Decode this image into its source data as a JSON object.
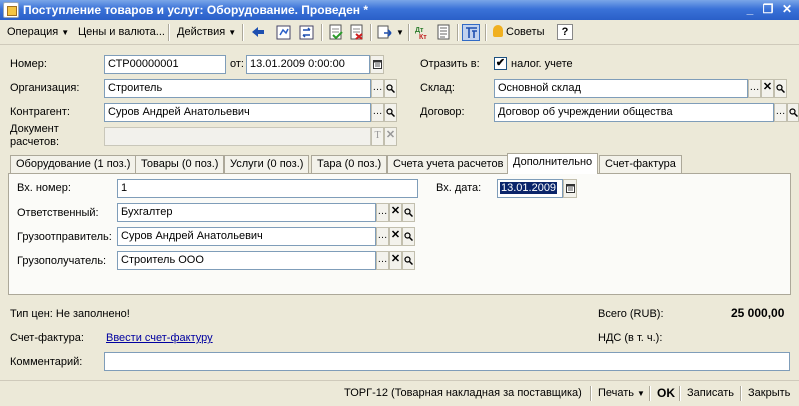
{
  "window": {
    "title": "Поступление товаров и услуг: Оборудование. Проведен *",
    "min": "_",
    "max": "❐",
    "close": "✕"
  },
  "toolbar": {
    "operation": "Операция",
    "prices": "Цены и валюта...",
    "actions": "Действия",
    "tips": "Советы",
    "help": "?"
  },
  "header": {
    "number_label": "Номер:",
    "number_value": "СТР00000001",
    "from_label": "от:",
    "date_value": "13.01.2009  0:00:00",
    "reflect_label": "Отразить в:",
    "tax_checkbox_mark": "✔",
    "tax_label": "налог. учете",
    "org_label": "Организация:",
    "org_value": "Строитель",
    "warehouse_label": "Склад:",
    "warehouse_value": "Основной склад",
    "contractor_label": "Контрагент:",
    "contractor_value": "Суров Андрей Анатольевич",
    "contract_label": "Договор:",
    "contract_value": "Договор об учреждении общества",
    "doc_label_line1": "Документ",
    "doc_label_line2": "расчетов:",
    "doc_value": ""
  },
  "tabs": [
    {
      "label": "Оборудование (1 поз.)"
    },
    {
      "label": "Товары (0 поз.)"
    },
    {
      "label": "Услуги (0 поз.)"
    },
    {
      "label": "Тара (0 поз.)"
    },
    {
      "label": "Счета учета расчетов"
    },
    {
      "label": "Дополнительно"
    },
    {
      "label": "Счет-фактура"
    }
  ],
  "active_tab": "Дополнительно",
  "extra": {
    "in_number_label": "Вх. номер:",
    "in_number_value": "1",
    "in_date_label": "Вх. дата:",
    "in_date_value": "13.01.2009",
    "responsible_label": "Ответственный:",
    "responsible_value": "Бухгалтер",
    "shipper_label": "Грузоотправитель:",
    "shipper_value": "Суров Андрей Анатольевич",
    "consignee_label": "Грузополучатель:",
    "consignee_value": "Строитель ООО"
  },
  "footer": {
    "price_type": "Тип цен: Не заполнено!",
    "total_label": "Всего (RUB):",
    "total_value": "25 000,00",
    "invoice_label": "Счет-фактура:",
    "invoice_link": "Ввести счет-фактуру",
    "vat_label": "НДС (в т. ч.):",
    "comment_label": "Комментарий:",
    "comment_value": ""
  },
  "statusbar": {
    "torg": "ТОРГ-12 (Товарная накладная за поставщика)",
    "print": "Печать",
    "ok": "OK",
    "save": "Записать",
    "close": "Закрыть"
  },
  "colors": {
    "title_gradient_start": "#7aa6e8",
    "title_gradient_end": "#2a5fc8",
    "window_bg": "#ece9d8",
    "input_border": "#7f9db9",
    "selection_bg": "#0a246a",
    "link": "#0000a0"
  }
}
